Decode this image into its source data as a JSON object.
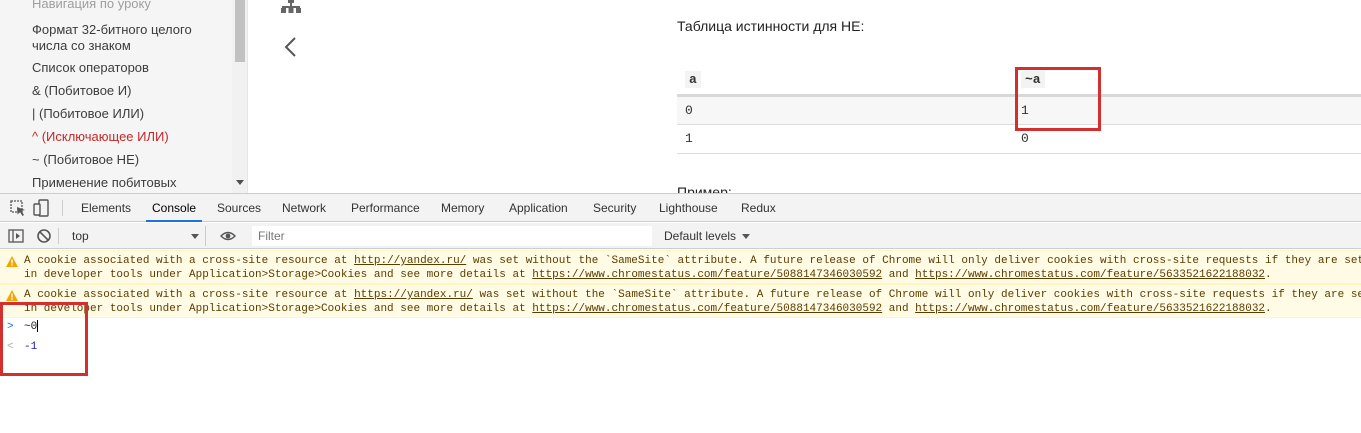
{
  "sidebar": {
    "items": [
      {
        "label": "Навигация по уроку",
        "state": "faded"
      },
      {
        "label": "Формат 32-битного целого числа со знаком",
        "state": "normal"
      },
      {
        "label": "Список операторов",
        "state": "normal"
      },
      {
        "label": "& (Побитовое И)",
        "state": "normal"
      },
      {
        "label": "| (Побитовое ИЛИ)",
        "state": "normal"
      },
      {
        "label": "^ (Исключающее ИЛИ)",
        "state": "active"
      },
      {
        "label": "~ (Побитовое НЕ)",
        "state": "normal"
      },
      {
        "label": "Применение побитовых",
        "state": "normal"
      }
    ]
  },
  "article": {
    "caption": "Таблица истинности для НЕ:",
    "table": {
      "headers": [
        "a",
        "~a"
      ],
      "rows": [
        [
          "0",
          "1"
        ],
        [
          "1",
          "0"
        ]
      ]
    },
    "example_label": "Пример:"
  },
  "devtools": {
    "tabs": [
      "Elements",
      "Console",
      "Sources",
      "Network",
      "Performance",
      "Memory",
      "Application",
      "Security",
      "Lighthouse",
      "Redux"
    ],
    "active_tab": "Console",
    "console_toolbar": {
      "context": "top",
      "filter_placeholder": "Filter",
      "levels": "Default levels"
    },
    "messages": [
      {
        "type": "warning",
        "line1_pre": "A cookie associated with a cross-site resource at ",
        "url": "http://yandex.ru/",
        "line1_post": " was set without the `SameSite` attribute. A future release of Chrome will only deliver cookies with cross-site requests if they are set",
        "line2_pre": "in developer tools under Application>Storage>Cookies and see more details at ",
        "link1": "https://www.chromestatus.com/feature/5088147346030592",
        "mid": " and ",
        "link2": "https://www.chromestatus.com/feature/5633521622188032",
        "end": "."
      },
      {
        "type": "warning",
        "line1_pre": "A cookie associated with a cross-site resource at ",
        "url": "https://yandex.ru/",
        "line1_post": " was set without the `SameSite` attribute. A future release of Chrome will only deliver cookies with cross-site requests if they are set",
        "line2_pre": "in developer tools under Application>Storage>Cookies and see more details at ",
        "link1": "https://www.chromestatus.com/feature/5088147346030592",
        "mid": " and ",
        "link2": "https://www.chromestatus.com/feature/5633521622188032",
        "end": "."
      }
    ],
    "input": "~0",
    "result": "-1"
  },
  "colors": {
    "accent_red": "#c62828",
    "highlight_red": "#d32f2f",
    "warning_bg": "#fffbe5",
    "active_tab_underline": "#1a73e8"
  }
}
